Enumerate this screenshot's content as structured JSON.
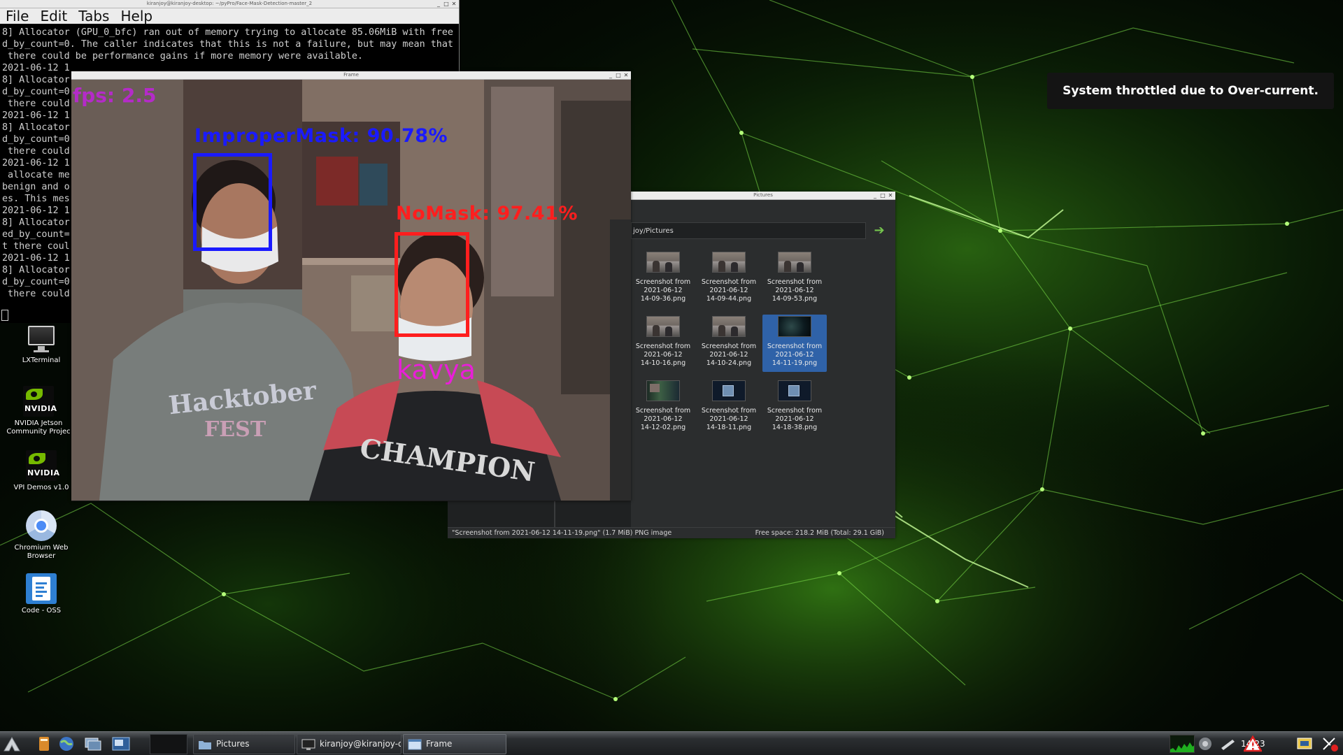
{
  "terminal": {
    "title": "kiranjoy@kiranjoy-desktop: ~/pyPro/Face-Mask-Detection-master_2",
    "menu": [
      "File",
      "Edit",
      "Tabs",
      "Help"
    ],
    "lines": [
      "8] Allocator (GPU_0_bfc) ran out of memory trying to allocate 85.06MiB with free",
      "d_by_count=0. The caller indicates that this is not a failure, but may mean that",
      " there could be performance gains if more memory were available.",
      "2021-06-12 1",
      "8] Allocator",
      "d_by_count=0",
      " there could",
      "2021-06-12 1",
      "8] Allocator",
      "d_by_count=0",
      " there could",
      "2021-06-12 1",
      " allocate me",
      "benign and o",
      "es. This mes",
      "2021-06-12 1",
      "8] Allocator",
      "ed_by_count=",
      "t there coul",
      "2021-06-12 1",
      "8] Allocator",
      "d_by_count=0",
      " there could"
    ]
  },
  "frame_window": {
    "title": "Frame",
    "fps": "fps: 2.5",
    "detections": [
      {
        "label": "ImproperMask: 90.78%",
        "color": "#1a1aff"
      },
      {
        "label": "NoMask: 97.41%",
        "color": "#ff1e1e"
      }
    ],
    "name_tag": "kavya",
    "name_color": "#e81fd8",
    "fps_color": "#b42bc8"
  },
  "pictures_window": {
    "title": "Pictures",
    "path": "joy/Pictures",
    "files": [
      {
        "name": [
          "Screenshot from",
          "2021-06-12",
          "14-09-36.png"
        ],
        "thumb": "room",
        "selected": false
      },
      {
        "name": [
          "Screenshot from",
          "2021-06-12",
          "14-09-44.png"
        ],
        "thumb": "room",
        "selected": false
      },
      {
        "name": [
          "Screenshot from",
          "2021-06-12",
          "14-09-53.png"
        ],
        "thumb": "room",
        "selected": false
      },
      {
        "name": [
          "Screenshot from",
          "2021-06-12",
          "14-10-16.png"
        ],
        "thumb": "room",
        "selected": false
      },
      {
        "name": [
          "Screenshot from",
          "2021-06-12",
          "14-10-24.png"
        ],
        "thumb": "room",
        "selected": false
      },
      {
        "name": [
          "Screenshot from",
          "2021-06-12",
          "14-11-19.png"
        ],
        "thumb": "desk",
        "selected": true
      },
      {
        "name": [
          "Screenshot from",
          "2021-06-12",
          "14-12-02.png"
        ],
        "thumb": "desk2",
        "selected": false
      },
      {
        "name": [
          "Screenshot from",
          "2021-06-12",
          "14-18-11.png"
        ],
        "thumb": "win",
        "selected": false
      },
      {
        "name": [
          "Screenshot from",
          "2021-06-12",
          "14-18-38.png"
        ],
        "thumb": "win",
        "selected": false
      }
    ],
    "status_left": "\"Screenshot from 2021-06-12 14-11-19.png\" (1.7 MiB) PNG image",
    "status_right": "Free space: 218.2 MiB (Total: 29.1 GiB)"
  },
  "notification": {
    "text": "System throttled due to Over-current."
  },
  "desktop_icons": [
    {
      "label": [
        "LXTerminal"
      ],
      "icon": "monitor-icon"
    },
    {
      "label": [
        "NVIDIA Jetson",
        "Community Projec"
      ],
      "icon": "nvidia-icon"
    },
    {
      "label": [
        "VPI Demos v1.0"
      ],
      "icon": "nvidia-icon"
    },
    {
      "label": [
        "Chromium Web",
        "Browser"
      ],
      "icon": "chromium-icon"
    },
    {
      "label": [
        "Code - OSS"
      ],
      "icon": "code-icon"
    }
  ],
  "nvidia_wordmark": "NVIDIA",
  "taskbar": {
    "tasks": [
      {
        "label": "Pictures",
        "icon": "folder-icon"
      },
      {
        "label": "kiranjoy@kiranjoy-d...",
        "icon": "terminal-icon"
      },
      {
        "label": "Frame",
        "icon": "window-icon"
      }
    ],
    "clock": "14:23"
  },
  "colors": {
    "accent_green": "#76b900",
    "selection_blue": "#2f62a8",
    "warning_red": "#e02020"
  }
}
